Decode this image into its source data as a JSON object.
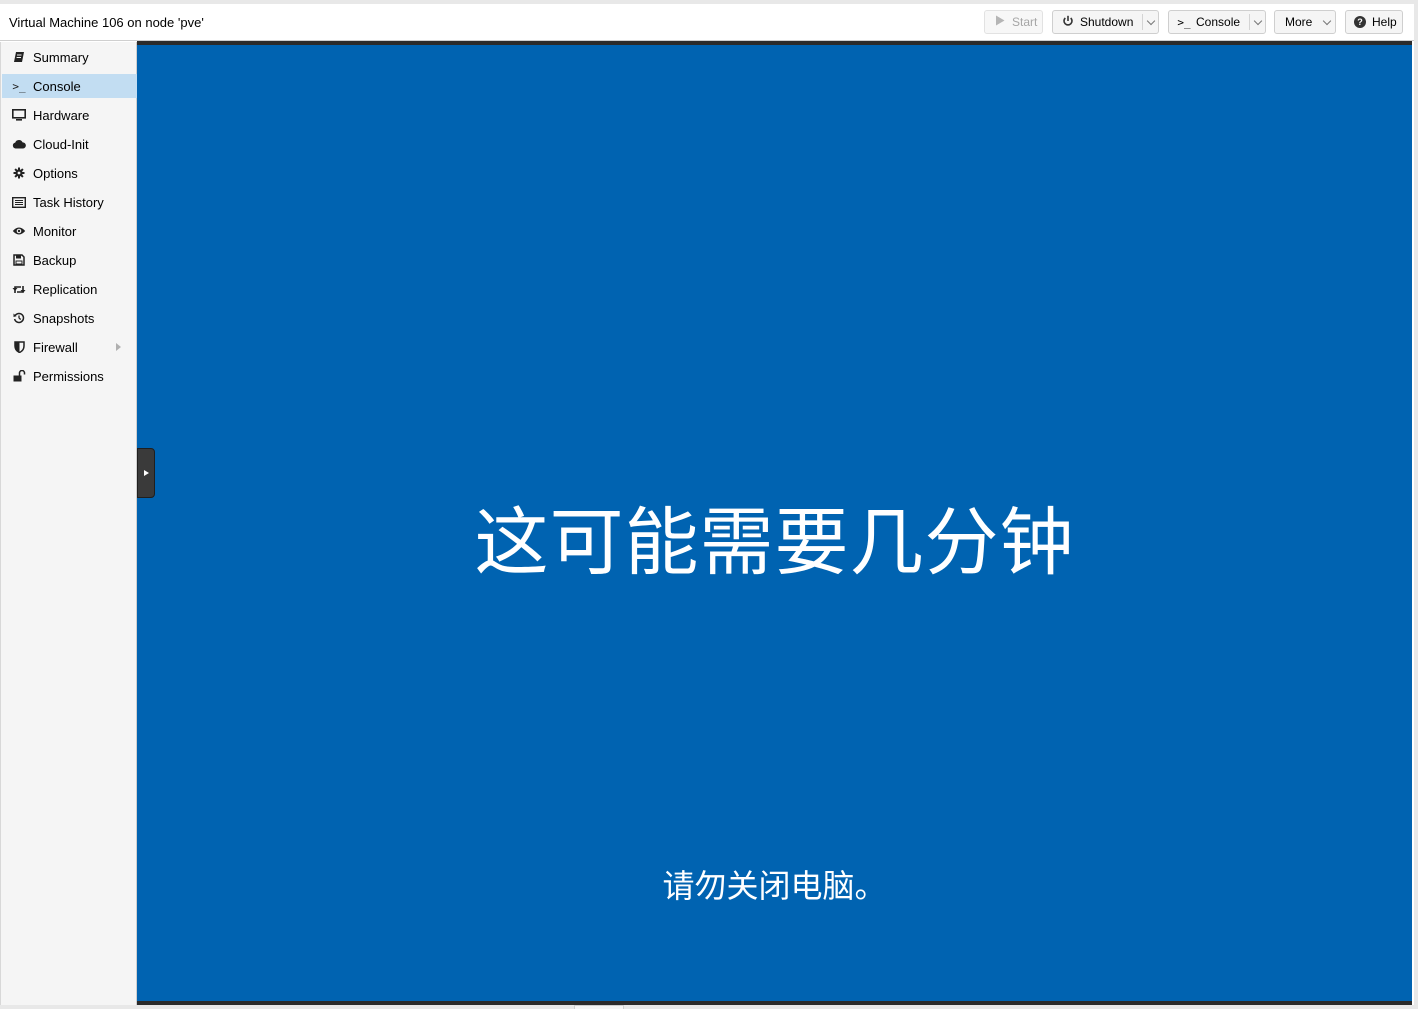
{
  "window": {
    "title": "Virtual Machine 106 on node 'pve'"
  },
  "toolbar": {
    "start_label": "Start",
    "shutdown_label": "Shutdown",
    "console_label": "Console",
    "more_label": "More",
    "help_label": "Help"
  },
  "sidebar": {
    "items": [
      {
        "label": "Summary",
        "icon": "book-icon"
      },
      {
        "label": "Console",
        "icon": "terminal-icon",
        "active": true
      },
      {
        "label": "Hardware",
        "icon": "monitor-icon"
      },
      {
        "label": "Cloud-Init",
        "icon": "cloud-icon"
      },
      {
        "label": "Options",
        "icon": "gear-icon"
      },
      {
        "label": "Task History",
        "icon": "list-icon"
      },
      {
        "label": "Monitor",
        "icon": "eye-icon"
      },
      {
        "label": "Backup",
        "icon": "floppy-icon"
      },
      {
        "label": "Replication",
        "icon": "retweet-icon"
      },
      {
        "label": "Snapshots",
        "icon": "history-icon"
      },
      {
        "label": "Firewall",
        "icon": "shield-icon",
        "has_submenu": true
      },
      {
        "label": "Permissions",
        "icon": "unlock-icon"
      }
    ]
  },
  "console": {
    "background": "#0063b1",
    "main_message": "这可能需要几分钟",
    "sub_message": "请勿关闭电脑。"
  },
  "colors": {
    "active_item": "#c2ddf2",
    "console_border": "#2b2b2b"
  }
}
